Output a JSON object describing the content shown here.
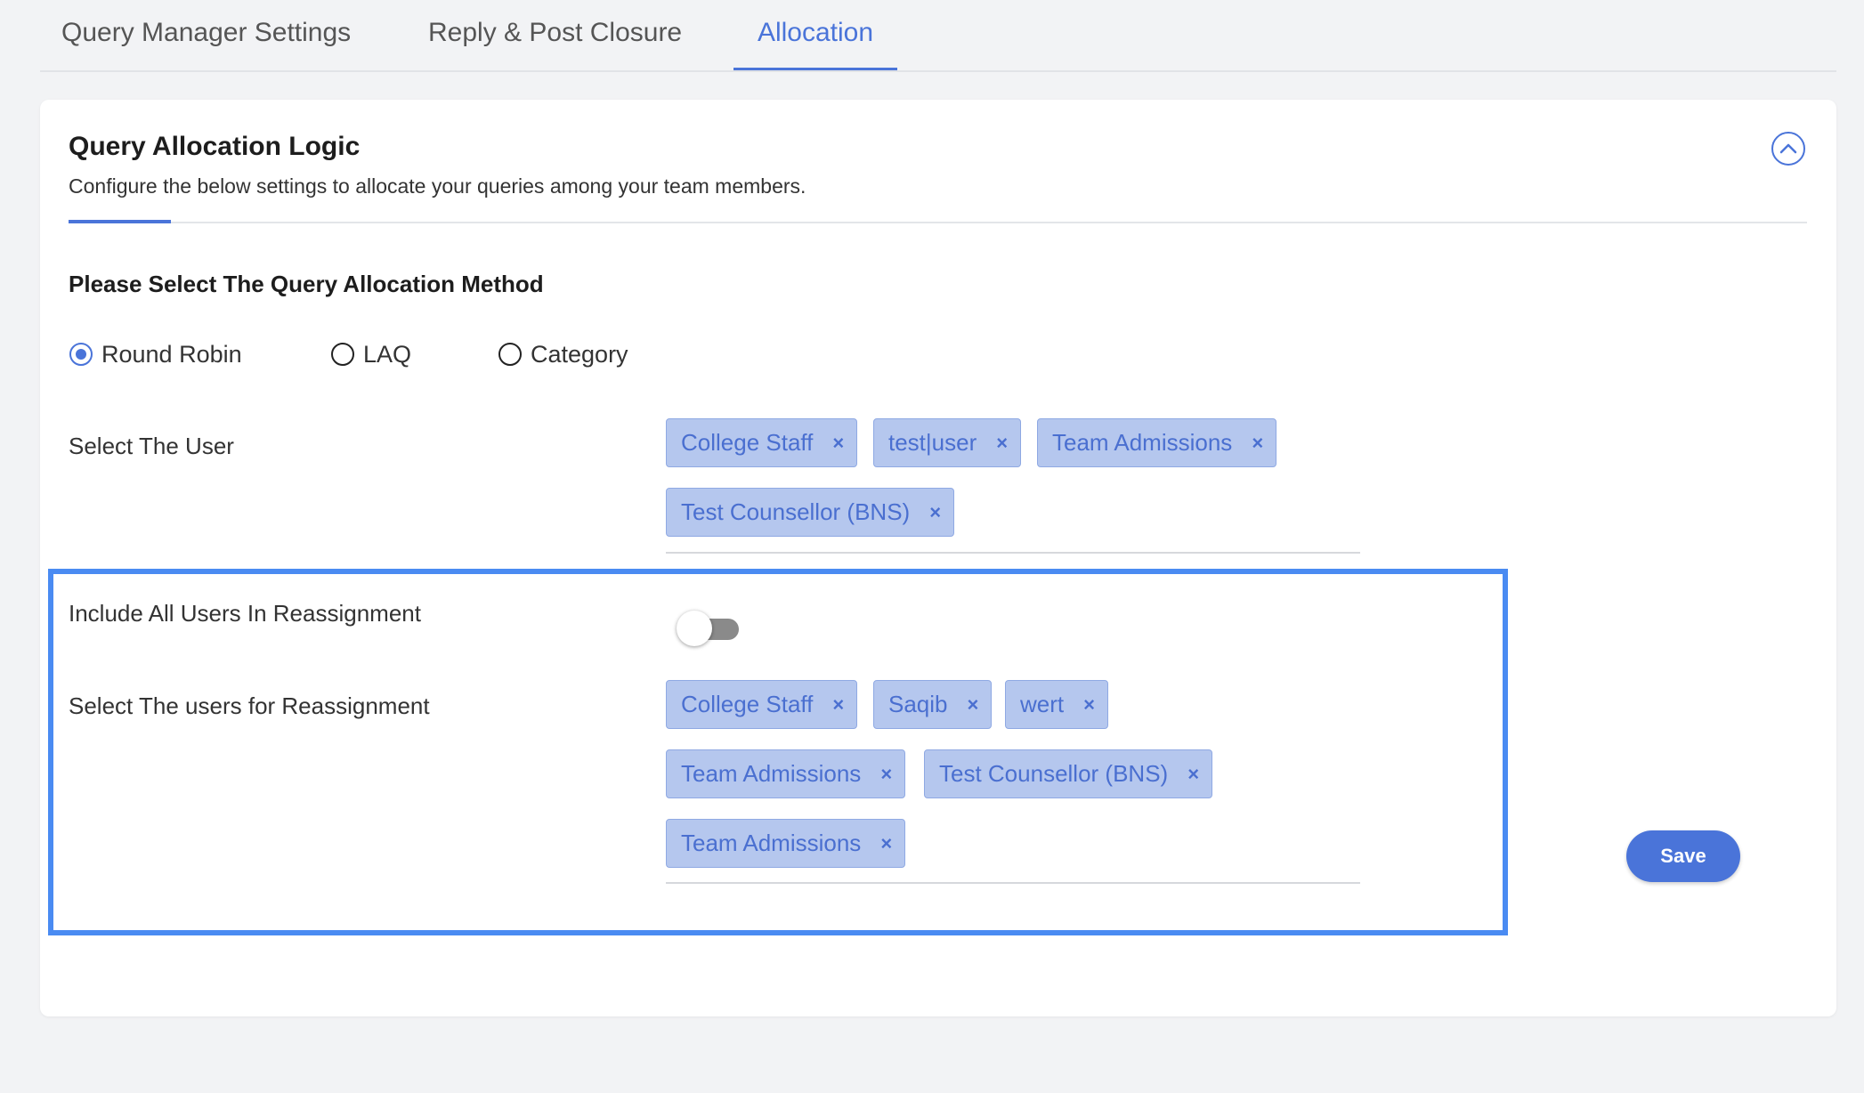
{
  "tabs": [
    {
      "label": "Query Manager Settings",
      "active": false
    },
    {
      "label": "Reply & Post Closure",
      "active": false
    },
    {
      "label": "Allocation",
      "active": true
    }
  ],
  "card": {
    "title": "Query Allocation Logic",
    "subtitle": "Configure the below settings to allocate your queries among your team members.",
    "collapse_icon": "chevron-up-icon"
  },
  "allocation_method": {
    "title": "Please Select The Query Allocation Method",
    "options": [
      {
        "label": "Round Robin",
        "checked": true
      },
      {
        "label": "LAQ",
        "checked": false
      },
      {
        "label": "Category",
        "checked": false
      }
    ]
  },
  "select_user": {
    "label": "Select The User",
    "chips": [
      "College Staff",
      "test|user",
      "Team Admissions",
      "Test Counsellor (BNS)"
    ]
  },
  "reassignment": {
    "include_all_label": "Include All Users In Reassignment",
    "include_all_enabled": false,
    "select_label": "Select The users for Reassignment",
    "chips": [
      "College Staff",
      "Saqib",
      "wert",
      "Team Admissions",
      "Test Counsellor (BNS)",
      "Team Admissions"
    ]
  },
  "remove_chip_symbol": "×",
  "save_label": "Save",
  "colors": {
    "accent": "#4a74d9",
    "chip_bg": "#b5c7ee",
    "highlight_border": "#4a8bf2"
  }
}
